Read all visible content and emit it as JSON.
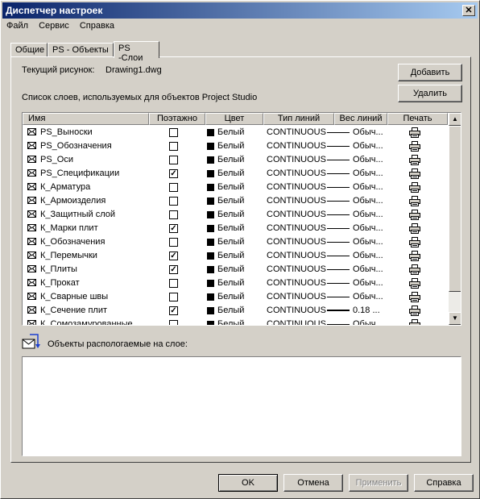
{
  "window": {
    "title": "Диспетчер настроек",
    "close_glyph": "✕"
  },
  "menu": [
    "Файл",
    "Сервис",
    "Справка"
  ],
  "tabs": [
    {
      "label": "Общие",
      "active": false
    },
    {
      "label": "PS - Объекты",
      "active": false
    },
    {
      "label": "PS -Слои",
      "active": true
    }
  ],
  "panel": {
    "current_drawing_label": "Текущий рисунок:",
    "current_drawing_value": "Drawing1.dwg",
    "layer_list_caption": "Список слоев, используемых для объектов Project Studio",
    "add_button": "Добавить",
    "delete_button": "Удалить",
    "objects_on_layer_label": "Объекты распологаемые на слое:"
  },
  "columns": [
    "Имя",
    "Поэтажно",
    "Цвет",
    "Тип линий",
    "Вес линий",
    "Печать"
  ],
  "layers": [
    {
      "name": "PS_Выноски",
      "floor": false,
      "color": "Белый",
      "linetype": "CONTINUOUS",
      "weight": "Обыч..."
    },
    {
      "name": "PS_Обозначения",
      "floor": false,
      "color": "Белый",
      "linetype": "CONTINUOUS",
      "weight": "Обыч..."
    },
    {
      "name": "PS_Оси",
      "floor": false,
      "color": "Белый",
      "linetype": "CONTINUOUS",
      "weight": "Обыч..."
    },
    {
      "name": "PS_Спецификации",
      "floor": true,
      "color": "Белый",
      "linetype": "CONTINUOUS",
      "weight": "Обыч..."
    },
    {
      "name": "К_Арматура",
      "floor": false,
      "color": "Белый",
      "linetype": "CONTINUOUS",
      "weight": "Обыч..."
    },
    {
      "name": "К_Армоизделия",
      "floor": false,
      "color": "Белый",
      "linetype": "CONTINUOUS",
      "weight": "Обыч..."
    },
    {
      "name": "К_Защитный слой",
      "floor": false,
      "color": "Белый",
      "linetype": "CONTINUOUS",
      "weight": "Обыч..."
    },
    {
      "name": "К_Марки плит",
      "floor": true,
      "color": "Белый",
      "linetype": "CONTINUOUS",
      "weight": "Обыч..."
    },
    {
      "name": "К_Обозначения",
      "floor": false,
      "color": "Белый",
      "linetype": "CONTINUOUS",
      "weight": "Обыч..."
    },
    {
      "name": "К_Перемычки",
      "floor": true,
      "color": "Белый",
      "linetype": "CONTINUOUS",
      "weight": "Обыч..."
    },
    {
      "name": "К_Плиты",
      "floor": true,
      "color": "Белый",
      "linetype": "CONTINUOUS",
      "weight": "Обыч..."
    },
    {
      "name": "К_Прокат",
      "floor": false,
      "color": "Белый",
      "linetype": "CONTINUOUS",
      "weight": "Обыч..."
    },
    {
      "name": "К_Сварные швы",
      "floor": false,
      "color": "Белый",
      "linetype": "CONTINUOUS",
      "weight": "Обыч..."
    },
    {
      "name": "К_Сечение плит",
      "floor": true,
      "color": "Белый",
      "linetype": "CONTINUOUS",
      "weight": "0.18 ..."
    },
    {
      "name": "К_Сомозамурованные",
      "floor": false,
      "color": "Белый",
      "linetype": "CONTINUOUS",
      "weight": "Обыч..."
    }
  ],
  "buttons": {
    "ok": "OK",
    "cancel": "Отмена",
    "apply": "Применить",
    "help": "Справка"
  },
  "icons": {
    "layer": "envelope-icon",
    "print": "printer-icon",
    "check": "✓"
  }
}
